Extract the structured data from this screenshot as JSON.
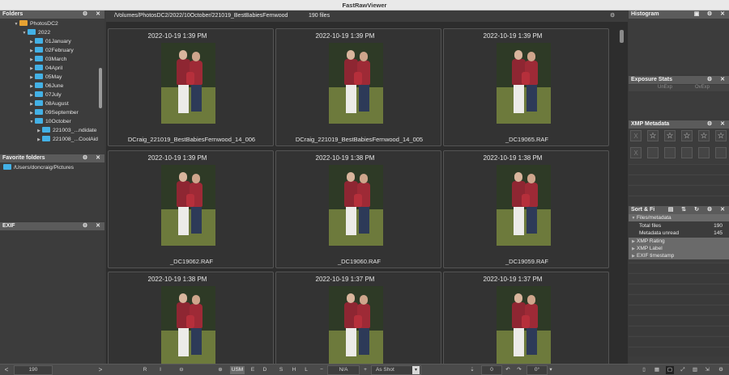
{
  "window": {
    "title": "FastRawViewer"
  },
  "folders_panel": {
    "title": "Folders",
    "tree": [
      {
        "label": "PhotosDC2",
        "arrow": "▼",
        "color": "orange"
      },
      {
        "label": "2022",
        "arrow": "▼"
      },
      {
        "label": "01January",
        "arrow": "▶"
      },
      {
        "label": "02February",
        "arrow": "▶"
      },
      {
        "label": "03March",
        "arrow": "▶"
      },
      {
        "label": "04April",
        "arrow": "▶"
      },
      {
        "label": "05May",
        "arrow": "▶"
      },
      {
        "label": "06June",
        "arrow": "▶"
      },
      {
        "label": "07July",
        "arrow": "▶"
      },
      {
        "label": "08August",
        "arrow": "▶"
      },
      {
        "label": "09September",
        "arrow": "▶"
      },
      {
        "label": "10October",
        "arrow": "▼"
      },
      {
        "label": "221003_...ndidate",
        "arrow": "▶"
      },
      {
        "label": "221008_...CoolAid",
        "arrow": "▶"
      }
    ]
  },
  "favorites_panel": {
    "title": "Favorite folders",
    "items": [
      "/Users/doncraig/Pictures"
    ]
  },
  "exif_panel": {
    "title": "EXIF"
  },
  "pathbar": {
    "path": "/Volumes/PhotosDC2/2022/10October/221019_BestBabiesFernwood",
    "count": "190 files"
  },
  "thumbnails": [
    {
      "date": "2022-10-19 1:39 PM",
      "file": "DCraig_221019_BestBabiesFernwood_14_006"
    },
    {
      "date": "2022-10-19 1:39 PM",
      "file": "DCraig_221019_BestBabiesFernwood_14_005"
    },
    {
      "date": "2022-10-19 1:39 PM",
      "file": "_DC19065.RAF"
    },
    {
      "date": "2022-10-19 1:39 PM",
      "file": "_DC19062.RAF"
    },
    {
      "date": "2022-10-19 1:38 PM",
      "file": "_DC19060.RAF"
    },
    {
      "date": "2022-10-19 1:38 PM",
      "file": "_DC19059.RAF"
    },
    {
      "date": "2022-10-19 1:38 PM",
      "file": ""
    },
    {
      "date": "2022-10-19 1:37 PM",
      "file": ""
    },
    {
      "date": "2022-10-19 1:37 PM",
      "file": ""
    }
  ],
  "histogram_panel": {
    "title": "Histogram"
  },
  "exposure_panel": {
    "title": "Exposure Stats",
    "col1": "UnExp",
    "col2": "OvExp"
  },
  "xmp_panel": {
    "title": "XMP Metadata",
    "stars": [
      "☆",
      "☆",
      "☆",
      "☆",
      "☆"
    ],
    "reject": "X"
  },
  "sort_panel": {
    "title": "Sort & Fi",
    "section": "Files/metadata",
    "rows": [
      {
        "label": "Total files",
        "value": "190"
      },
      {
        "label": "Metadata unread",
        "value": "145"
      }
    ],
    "groups": [
      "XMP Rating",
      "XMP Label",
      "EXIF timestamp"
    ]
  },
  "statusbar": {
    "prev": "<",
    "next": ">",
    "count": "190",
    "r": "R",
    "i": "I",
    "usm": "USM",
    "e": "E",
    "d": "D",
    "s": "S",
    "h": "H",
    "l": "L",
    "minus": "−",
    "na": "N/A",
    "plus": "+",
    "wb": "As Shot",
    "zero": "0",
    "rot": "0°"
  }
}
